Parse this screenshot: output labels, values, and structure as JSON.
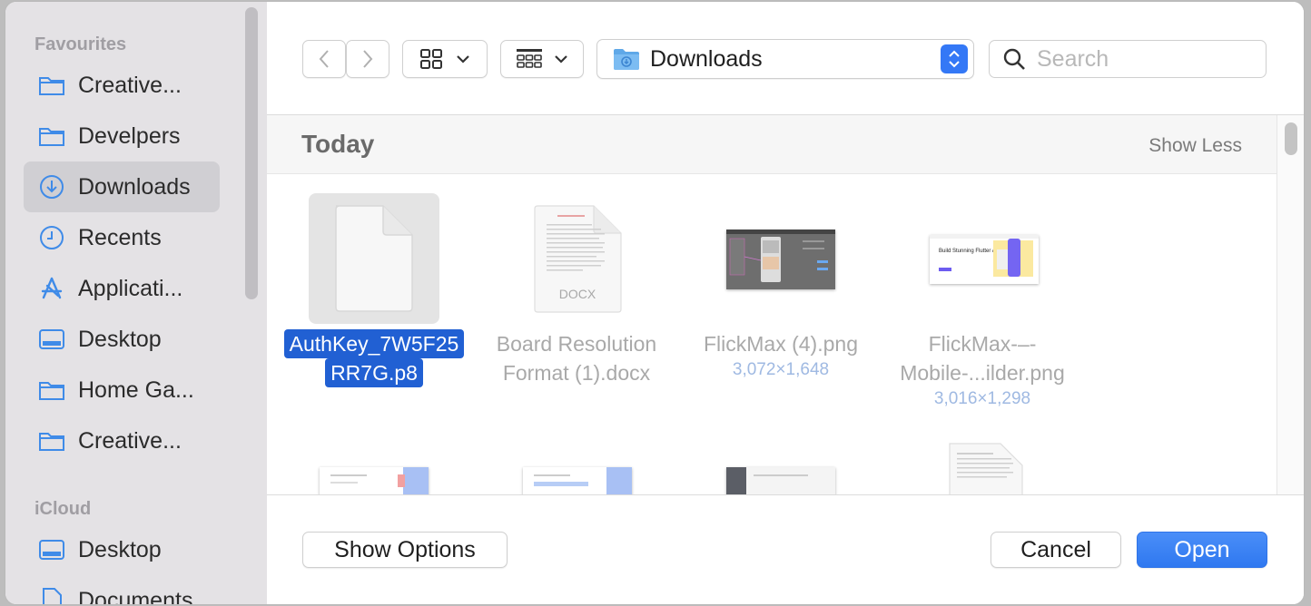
{
  "sidebar": {
    "favourites_heading": "Favourites",
    "favourites": [
      {
        "label": "Creative...",
        "icon": "folder-icon"
      },
      {
        "label": "Develpers",
        "icon": "folder-icon"
      },
      {
        "label": "Downloads",
        "icon": "download-icon",
        "selected": true
      },
      {
        "label": "Recents",
        "icon": "clock-icon"
      },
      {
        "label": "Applicati...",
        "icon": "applications-icon"
      },
      {
        "label": "Desktop",
        "icon": "desktop-icon"
      },
      {
        "label": "Home Ga...",
        "icon": "folder-icon"
      },
      {
        "label": "Creative...",
        "icon": "folder-icon"
      }
    ],
    "icloud_heading": "iCloud",
    "icloud": [
      {
        "label": "Desktop",
        "icon": "desktop-icon"
      },
      {
        "label": "Documents",
        "icon": "document-icon"
      }
    ]
  },
  "toolbar": {
    "location": "Downloads",
    "search_placeholder": "Search"
  },
  "section": {
    "title": "Today",
    "toggle": "Show Less"
  },
  "files": [
    {
      "name_line1": "AuthKey_7W5F25",
      "name_line2": "RR7G.p8",
      "meta": "",
      "selected": true
    },
    {
      "name_line1": "Board Resolution",
      "name_line2": "Format (1).docx",
      "meta": "",
      "badge": "DOCX"
    },
    {
      "name_line1": "FlickMax (4).png",
      "name_line2": "",
      "meta": "3,072×1,648"
    },
    {
      "name_line1": "FlickMax-–-",
      "name_line2": "Mobile-...ilder.png",
      "meta": "3,016×1,298",
      "thumb_text": "Build Stunning Flutter Apps in Minutes"
    }
  ],
  "buttons": {
    "show_options": "Show Options",
    "cancel": "Cancel",
    "open": "Open"
  },
  "colors": {
    "accent": "#3478f6",
    "selection": "#2160d3"
  }
}
